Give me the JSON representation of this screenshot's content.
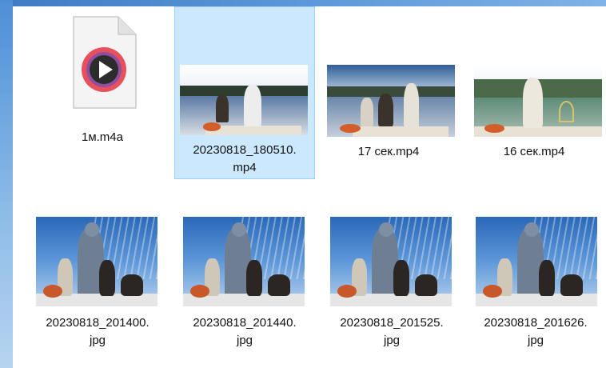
{
  "files": [
    {
      "name": "1м.m4a",
      "kind": "audio",
      "icon": "play-icon"
    },
    {
      "name": "20230818_180510.\nmp4",
      "kind": "video",
      "selected": true
    },
    {
      "name": "17 сек.mp4",
      "kind": "video"
    },
    {
      "name": "16 сек.mp4",
      "kind": "video"
    },
    {
      "name": "20230818_201400.\njpg",
      "kind": "image"
    },
    {
      "name": "20230818_201440.\njpg",
      "kind": "image"
    },
    {
      "name": "20230818_201525.\njpg",
      "kind": "image"
    },
    {
      "name": "20230818_201626.\njpg",
      "kind": "image"
    }
  ],
  "colors": {
    "selection_bg": "#cce8ff",
    "selection_border": "#99d1ff",
    "play_ring_outer": "#e8505b",
    "play_ring_inner": "#8e4fa0"
  }
}
